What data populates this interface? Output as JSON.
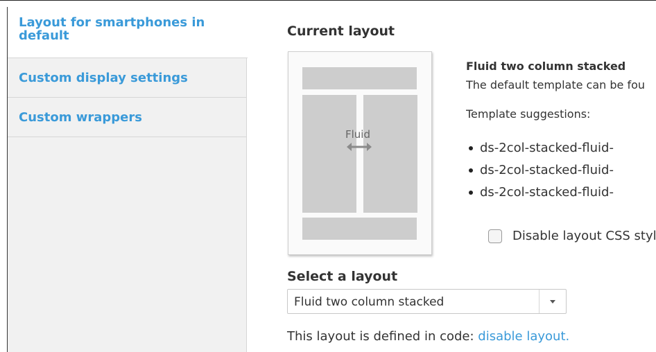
{
  "vertical_tabs": [
    {
      "label_line1": "Layout for smartphones in",
      "label_line2": "default",
      "active": true
    },
    {
      "label": "Custom display settings"
    },
    {
      "label": "Custom wrappers"
    }
  ],
  "current_layout": {
    "title": "Current layout",
    "thumbnail_label": "Fluid",
    "name": "Fluid two column stacked",
    "description": "The default template can be fou",
    "suggestions_label": "Template suggestions:",
    "suggestions": [
      "ds-2col-stacked-fluid-",
      "ds-2col-stacked-fluid-",
      "ds-2col-stacked-fluid-"
    ],
    "disable_css_label": "Disable layout CSS styl"
  },
  "select_layout": {
    "title": "Select a layout",
    "value": "Fluid two column stacked"
  },
  "defined_in_code": {
    "text": "This layout is defined in code: ",
    "link": "disable layout."
  },
  "colors": {
    "link": "#3a9ad9",
    "tab_background": "#f1f1f1",
    "thumbnail_block": "#cdcdcd"
  }
}
